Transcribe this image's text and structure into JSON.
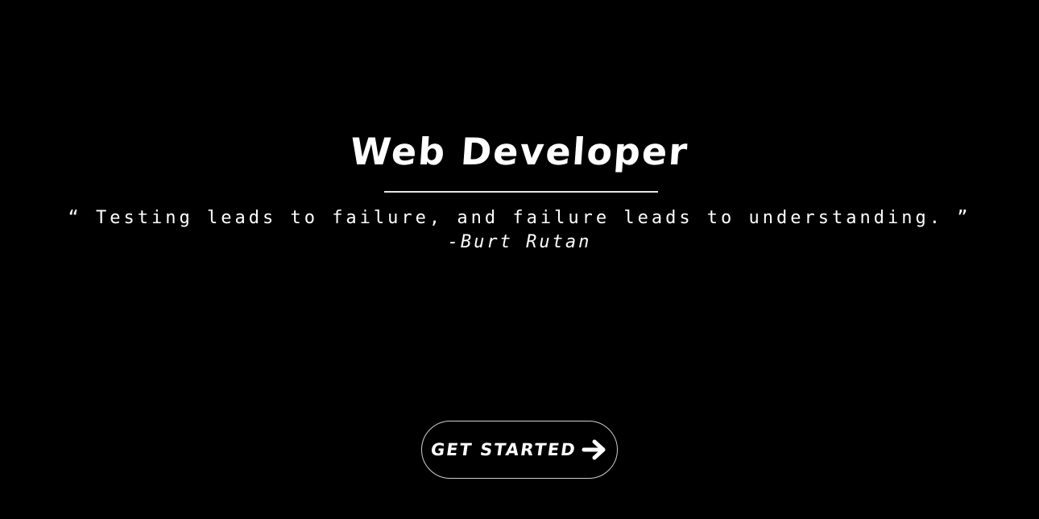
{
  "hero": {
    "title": "Web Developer",
    "quote": "“ Testing leads to failure, and failure leads to understanding. ”",
    "author": "-Burt Rutan"
  },
  "cta": {
    "label": "GET STARTED",
    "icon": "arrow-right-icon"
  },
  "colors": {
    "background": "#000000",
    "text": "#ffffff",
    "divider": "#e6e6e6",
    "button_border": "#d0d0d0"
  }
}
